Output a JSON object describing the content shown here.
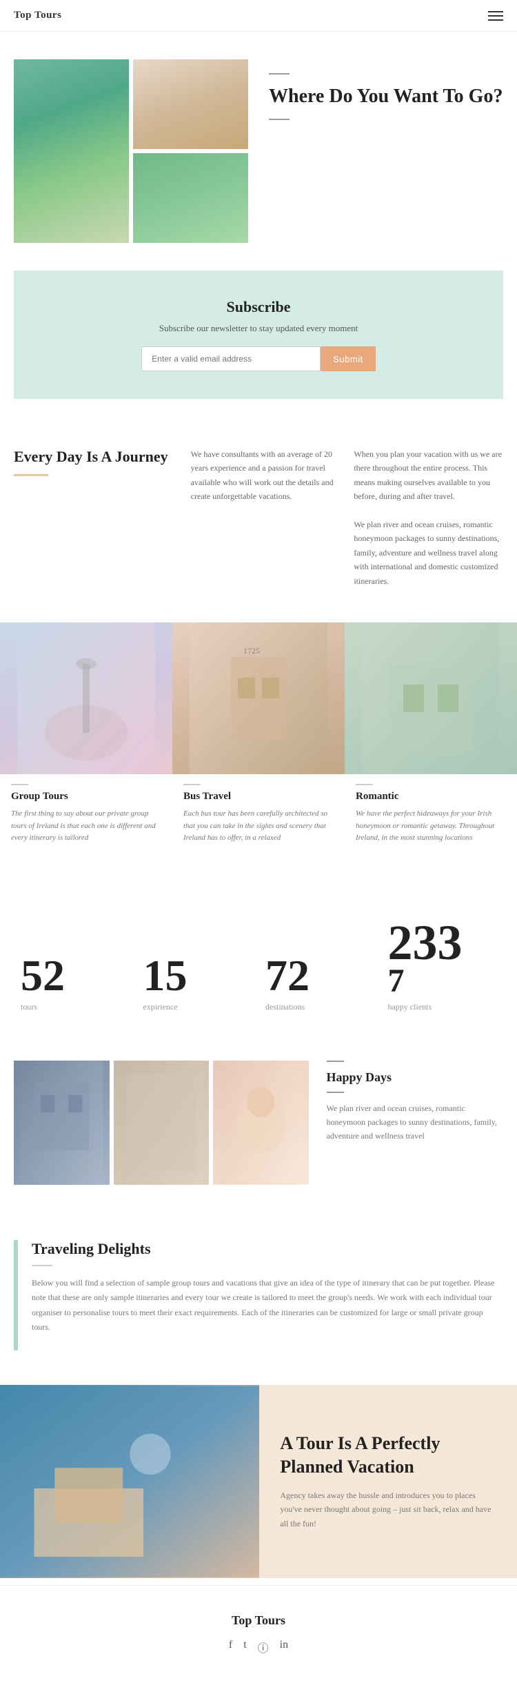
{
  "header": {
    "logo": "Top Tours"
  },
  "hero": {
    "divider": "—",
    "title": "Where Do You Want To Go?",
    "images": [
      "hero-main",
      "hero-top-right",
      "hero-bot-right"
    ]
  },
  "subscribe": {
    "title": "Subscribe",
    "description": "Subscribe our newsletter to stay updated every moment",
    "input_placeholder": "Enter a valid email address",
    "button_label": "Submit"
  },
  "journey": {
    "title": "Every Day Is A Journey",
    "col1": "We have consultants with an average of 20 years experience and a passion for travel available who will work out the details and create unforgettable vacations.",
    "col2": "When you plan your vacation with us we are there throughout the entire process. This means making ourselves available to you before, during and after travel.\n\nWe plan river and ocean cruises, romantic honeymoon packages to sunny destinations, family, adventure and wellness travel along with international and domestic customized itineraries."
  },
  "tours": [
    {
      "title": "Group Tours",
      "text": "The first thing to say about our private group tours of Ireland is that each one is different and every itinerary is tailored"
    },
    {
      "title": "Bus Travel",
      "text": "Each bus tour has been carefully architected so that you can take in the sights and scenery that Ireland has to offer, in a relaxed"
    },
    {
      "title": "Romantic",
      "text": "We have the perfect hideaways for your Irish honeymoon or romantic getaway. Throughout Ireland, in the most stunning locations"
    }
  ],
  "stats": [
    {
      "number": "52",
      "label": "tours"
    },
    {
      "number": "15",
      "label": "expirience"
    },
    {
      "number": "72",
      "label": "destinations"
    },
    {
      "number": "2337",
      "label": "happy clients"
    }
  ],
  "happy_days": {
    "title": "Happy Days",
    "text": "We plan river and ocean cruises, romantic honeymoon packages to sunny destinations, family, adventure and wellness travel"
  },
  "delights": {
    "title": "Traveling Delights",
    "text": "Below you will find a selection of sample group tours and vacations that give an idea of the type of itinerary that can be put together. Please note that these are only sample itineraries and every tour we create is tailored to meet the group's needs. We work with each individual tour organiser to personalise tours to meet their exact requirements. Each of the itineraries can be customized for large or small private group tours."
  },
  "vacation": {
    "title": "A Tour Is A Perfectly Planned Vacation",
    "text": "Agency takes away the hussle and introduces you to places you've never thought about going – just sit back, relax and have all the fun!"
  },
  "footer": {
    "logo": "Top Tours",
    "social": [
      "f",
      "t",
      "©",
      "in"
    ]
  }
}
